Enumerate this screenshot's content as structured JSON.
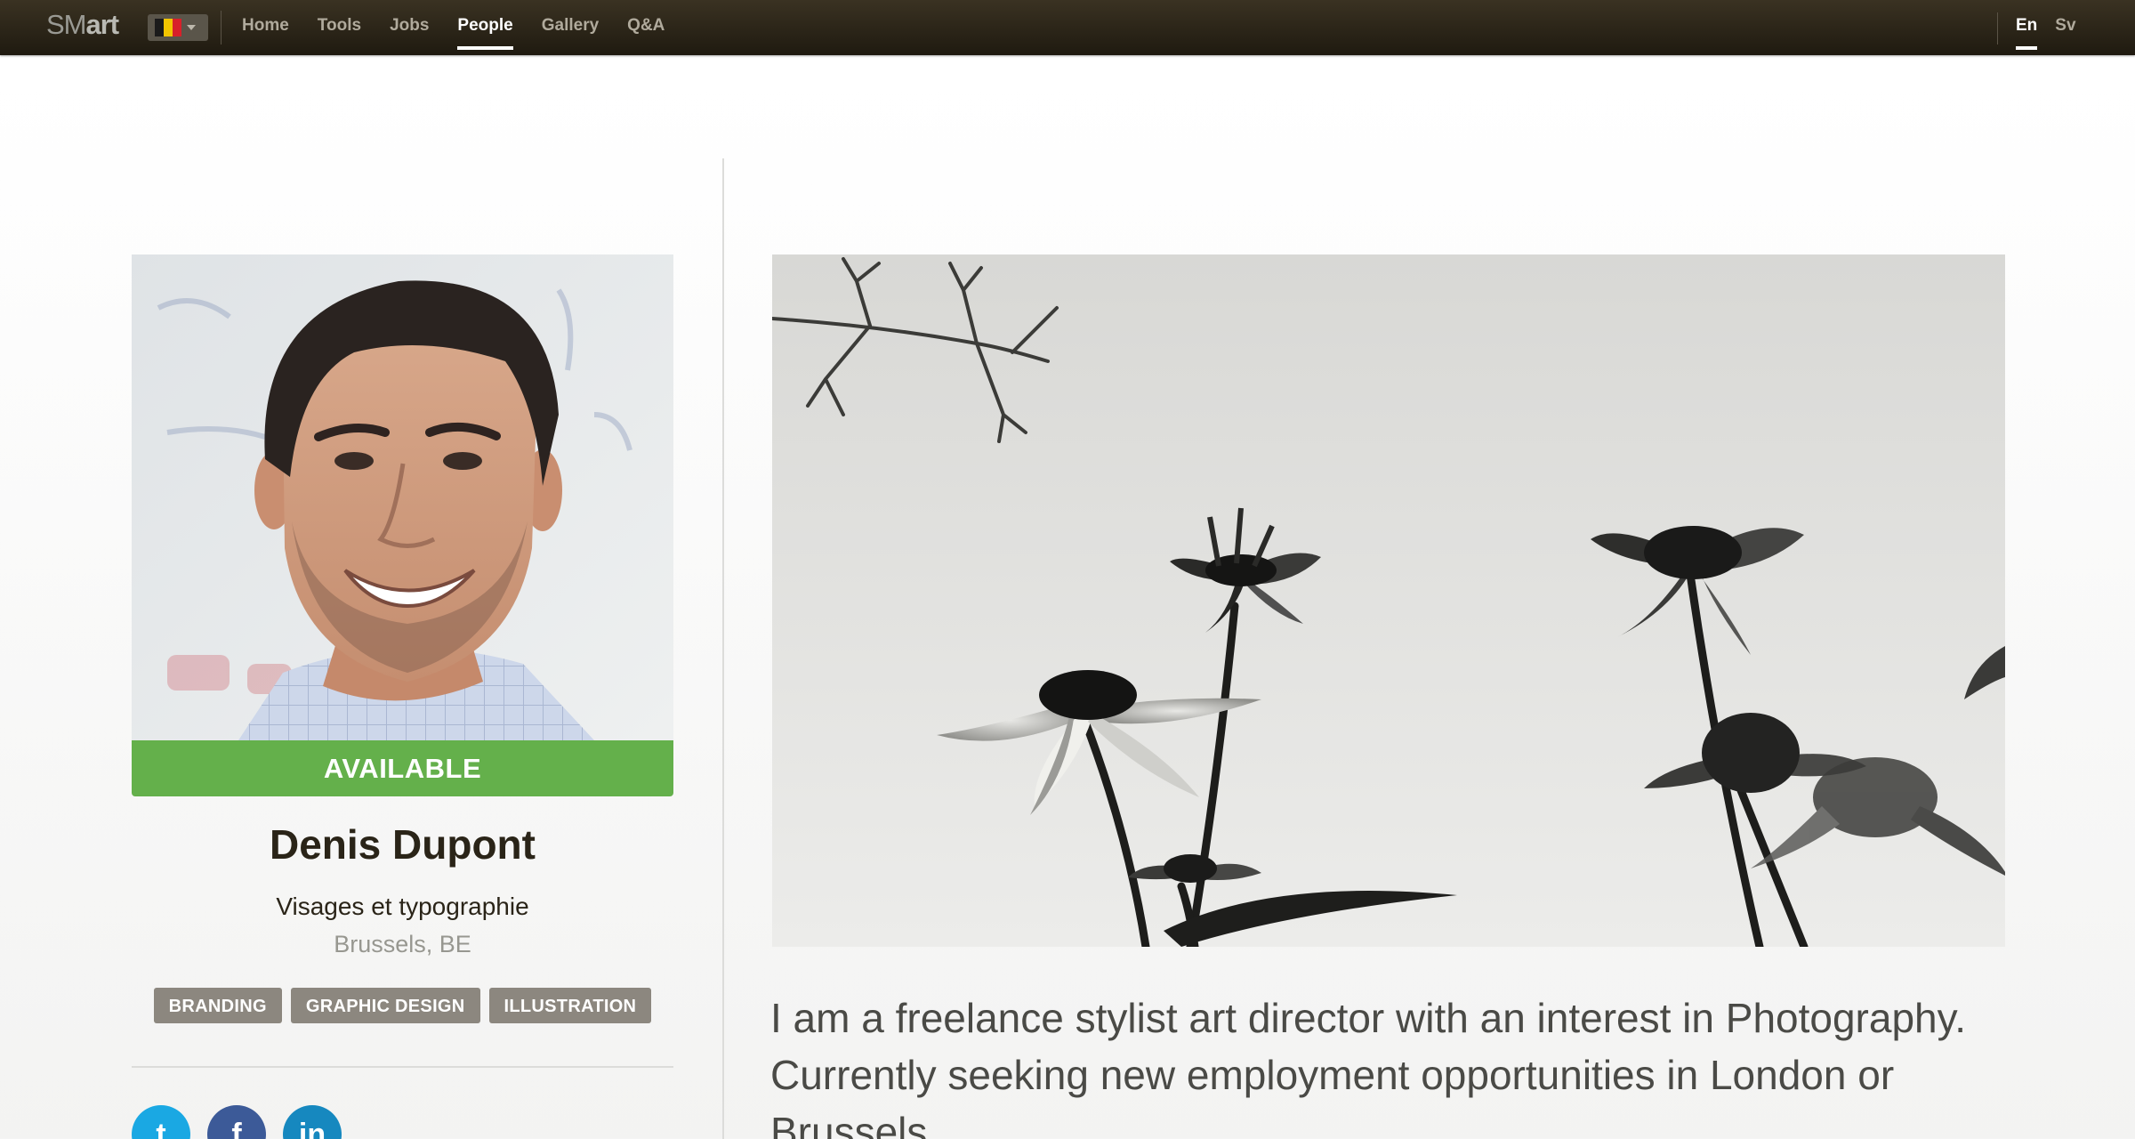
{
  "topbar": {
    "logo_light": "SM",
    "logo_bold": "art",
    "country_flag": "belgium-flag-icon",
    "flag_colors": [
      "#1b1b1b",
      "#f2c500",
      "#d8202a"
    ],
    "nav": [
      {
        "label": "Home"
      },
      {
        "label": "Tools"
      },
      {
        "label": "Jobs"
      },
      {
        "label": "People"
      },
      {
        "label": "Gallery"
      },
      {
        "label": "Q&A"
      }
    ],
    "active_nav": "People",
    "languages": [
      {
        "label": "En"
      },
      {
        "label": "Sv"
      }
    ],
    "active_language": "En"
  },
  "profile": {
    "status": "AVAILABLE",
    "status_color": "#64b04b",
    "name": "Denis Dupont",
    "title": "Visages et typographie",
    "location": "Brussels, BE",
    "tags": [
      "BRANDING",
      "GRAPHIC DESIGN",
      "ILLUSTRATION"
    ],
    "social": [
      {
        "icon": "twitter-icon",
        "glyph": "t"
      },
      {
        "icon": "facebook-icon",
        "glyph": "f"
      },
      {
        "icon": "linkedin-icon",
        "glyph": "in"
      }
    ]
  },
  "main": {
    "bio": "I am a freelance stylist art director with an interest in Photography. Currently seeking new employment opportunities in London or Brussels."
  }
}
